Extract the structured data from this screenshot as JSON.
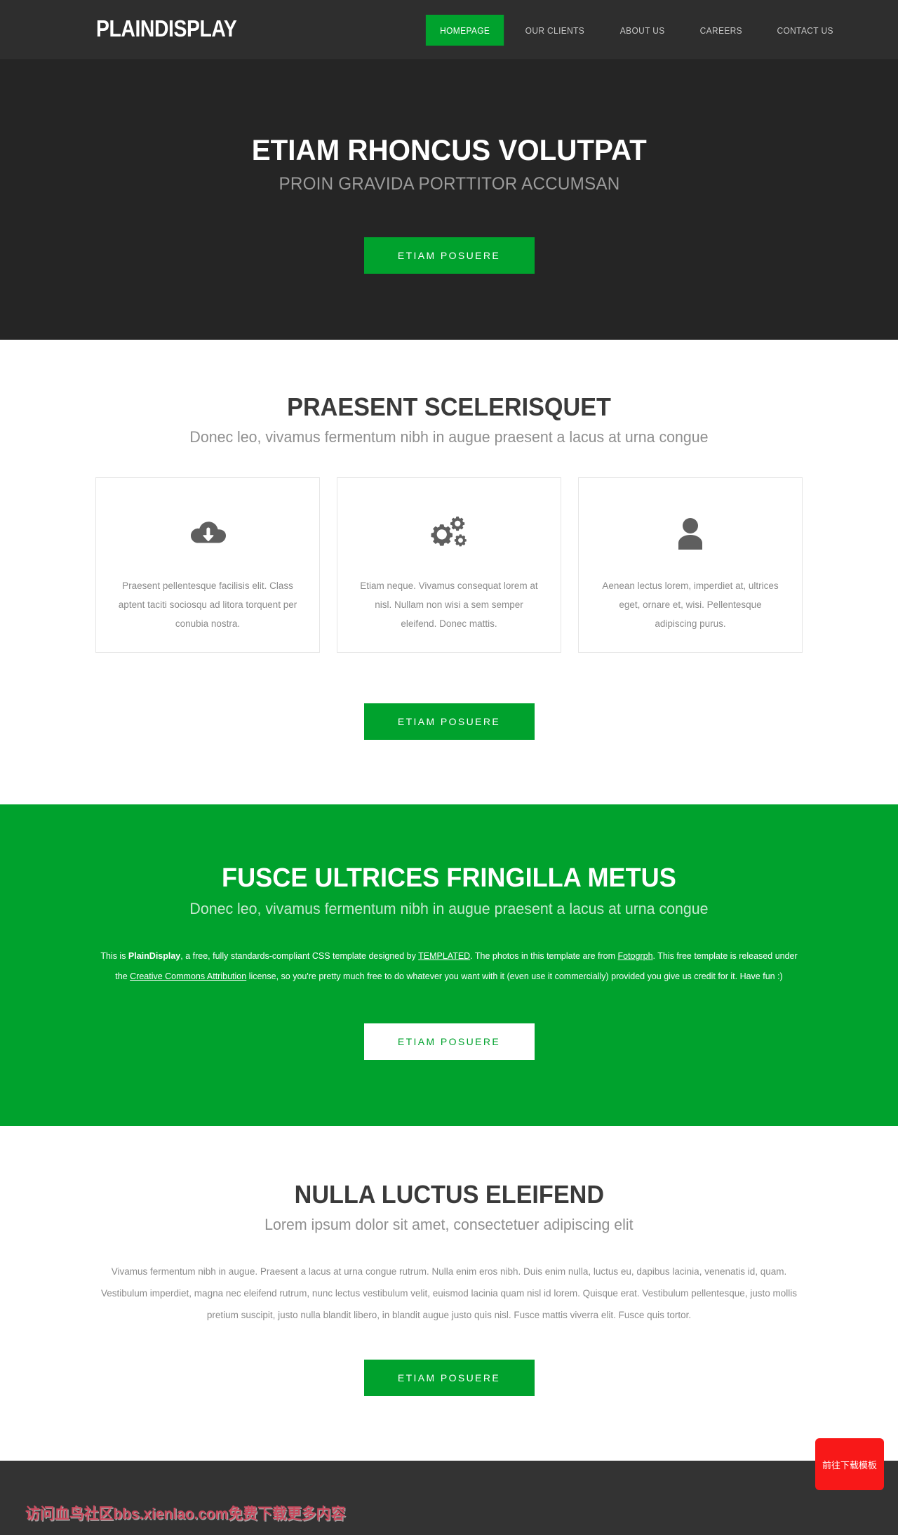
{
  "header": {
    "logo": "PLAINDISPLAY",
    "nav": [
      {
        "label": "HOMEPAGE",
        "active": true
      },
      {
        "label": "OUR CLIENTS",
        "active": false
      },
      {
        "label": "ABOUT US",
        "active": false
      },
      {
        "label": "CAREERS",
        "active": false
      },
      {
        "label": "CONTACT US",
        "active": false
      }
    ]
  },
  "banner": {
    "title": "ETIAM RHONCUS VOLUTPAT",
    "subtitle": "PROIN GRAVIDA PORTTITOR ACCUMSAN",
    "button": "ETIAM POSUERE"
  },
  "features": {
    "title": "PRAESENT SCELERISQUET",
    "subtitle": "Donec leo, vivamus fermentum nibh in augue praesent a lacus at urna congue",
    "boxes": [
      {
        "icon": "cloud-download-icon",
        "text": "Praesent pellentesque facilisis elit. Class aptent taciti sociosqu ad litora torquent per conubia nostra."
      },
      {
        "icon": "cogs-icon",
        "text": "Etiam neque. Vivamus consequat lorem at nisl. Nullam non wisi a sem semper eleifend. Donec mattis."
      },
      {
        "icon": "user-icon",
        "text": "Aenean lectus lorem, imperdiet at, ultrices eget, ornare et, wisi. Pellentesque adipiscing purus."
      }
    ],
    "button": "ETIAM POSUERE"
  },
  "highlight": {
    "title": "FUSCE ULTRICES FRINGILLA METUS",
    "subtitle": "Donec leo, vivamus fermentum nibh in augue praesent a lacus at urna congue",
    "credits": {
      "part1": "This is ",
      "brand": "PlainDisplay",
      "part2": ", a free, fully standards-compliant CSS template designed by ",
      "link1": "TEMPLATED",
      "part3": ". The photos in this template are from ",
      "link2": "Fotogrph",
      "part4": ". This free template is released under the ",
      "link3": "Creative Commons Attribution",
      "part5": " license, so you're pretty much free to do whatever you want with it (even use it commercially) provided you give us credit for it. Have fun :)"
    },
    "button": "ETIAM POSUERE"
  },
  "content": {
    "title": "NULLA LUCTUS ELEIFEND",
    "subtitle": "Lorem ipsum dolor sit amet, consectetuer adipiscing elit",
    "body": "Vivamus fermentum nibh in augue. Praesent a lacus at urna congue rutrum. Nulla enim eros nibh. Duis enim nulla, luctus eu, dapibus lacinia, venenatis id, quam. Vestibulum imperdiet, magna nec eleifend rutrum, nunc lectus vestibulum velit, euismod lacinia quam nisl id lorem. Quisque erat. Vestibulum pellentesque, justo mollis pretium suscipit, justo nulla blandit libero, in blandit augue justo quis nisl. Fusce mattis viverra elit. Fusce quis tortor.",
    "button": "ETIAM POSUERE"
  },
  "footer": {
    "watermark": "访问血鸟社区bbs.xienlao.com免费下载更多内容",
    "download_button": "前往下载模板"
  },
  "colors": {
    "accent_green": "#00a22d",
    "header_dark": "#2e2e2e",
    "banner_dark": "#252525",
    "footer_dark": "#333333",
    "download_red": "#f81818",
    "watermark_red": "#c94a5e"
  }
}
